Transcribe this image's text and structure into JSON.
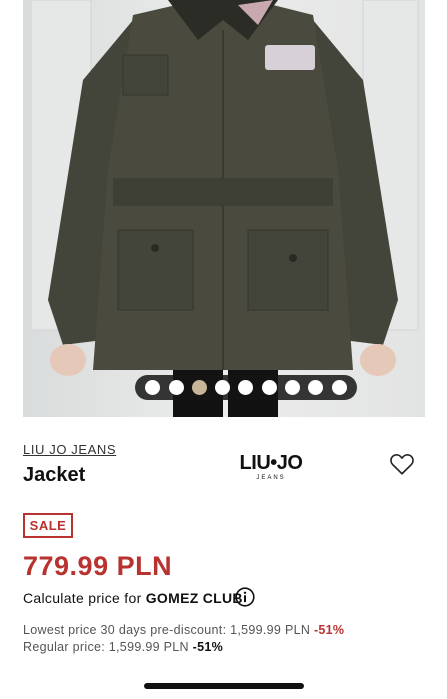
{
  "gallery": {
    "slide_count": 9,
    "active_slide": 3
  },
  "product": {
    "brand_link": "LIU JO JEANS",
    "title": "Jacket",
    "logo_main": "LIU•JO",
    "logo_sub": "JEANS",
    "sale_badge": "SALE",
    "price": "779.99 PLN"
  },
  "club": {
    "prefix": "Calculate price for",
    "name": "GOMEZ CLUB"
  },
  "price_history": {
    "lowest_label": "Lowest price 30 days pre-discount: 1,599.99 PLN",
    "lowest_discount": "-51%",
    "regular_label": "Regular price: 1,599.99 PLN",
    "regular_discount": "-51%"
  },
  "colors": {
    "sale_red": "#b8322f",
    "active_dot": "#c7b697",
    "jacket": "#4a4b3e"
  },
  "icons": [
    "heart-icon",
    "info-icon"
  ]
}
